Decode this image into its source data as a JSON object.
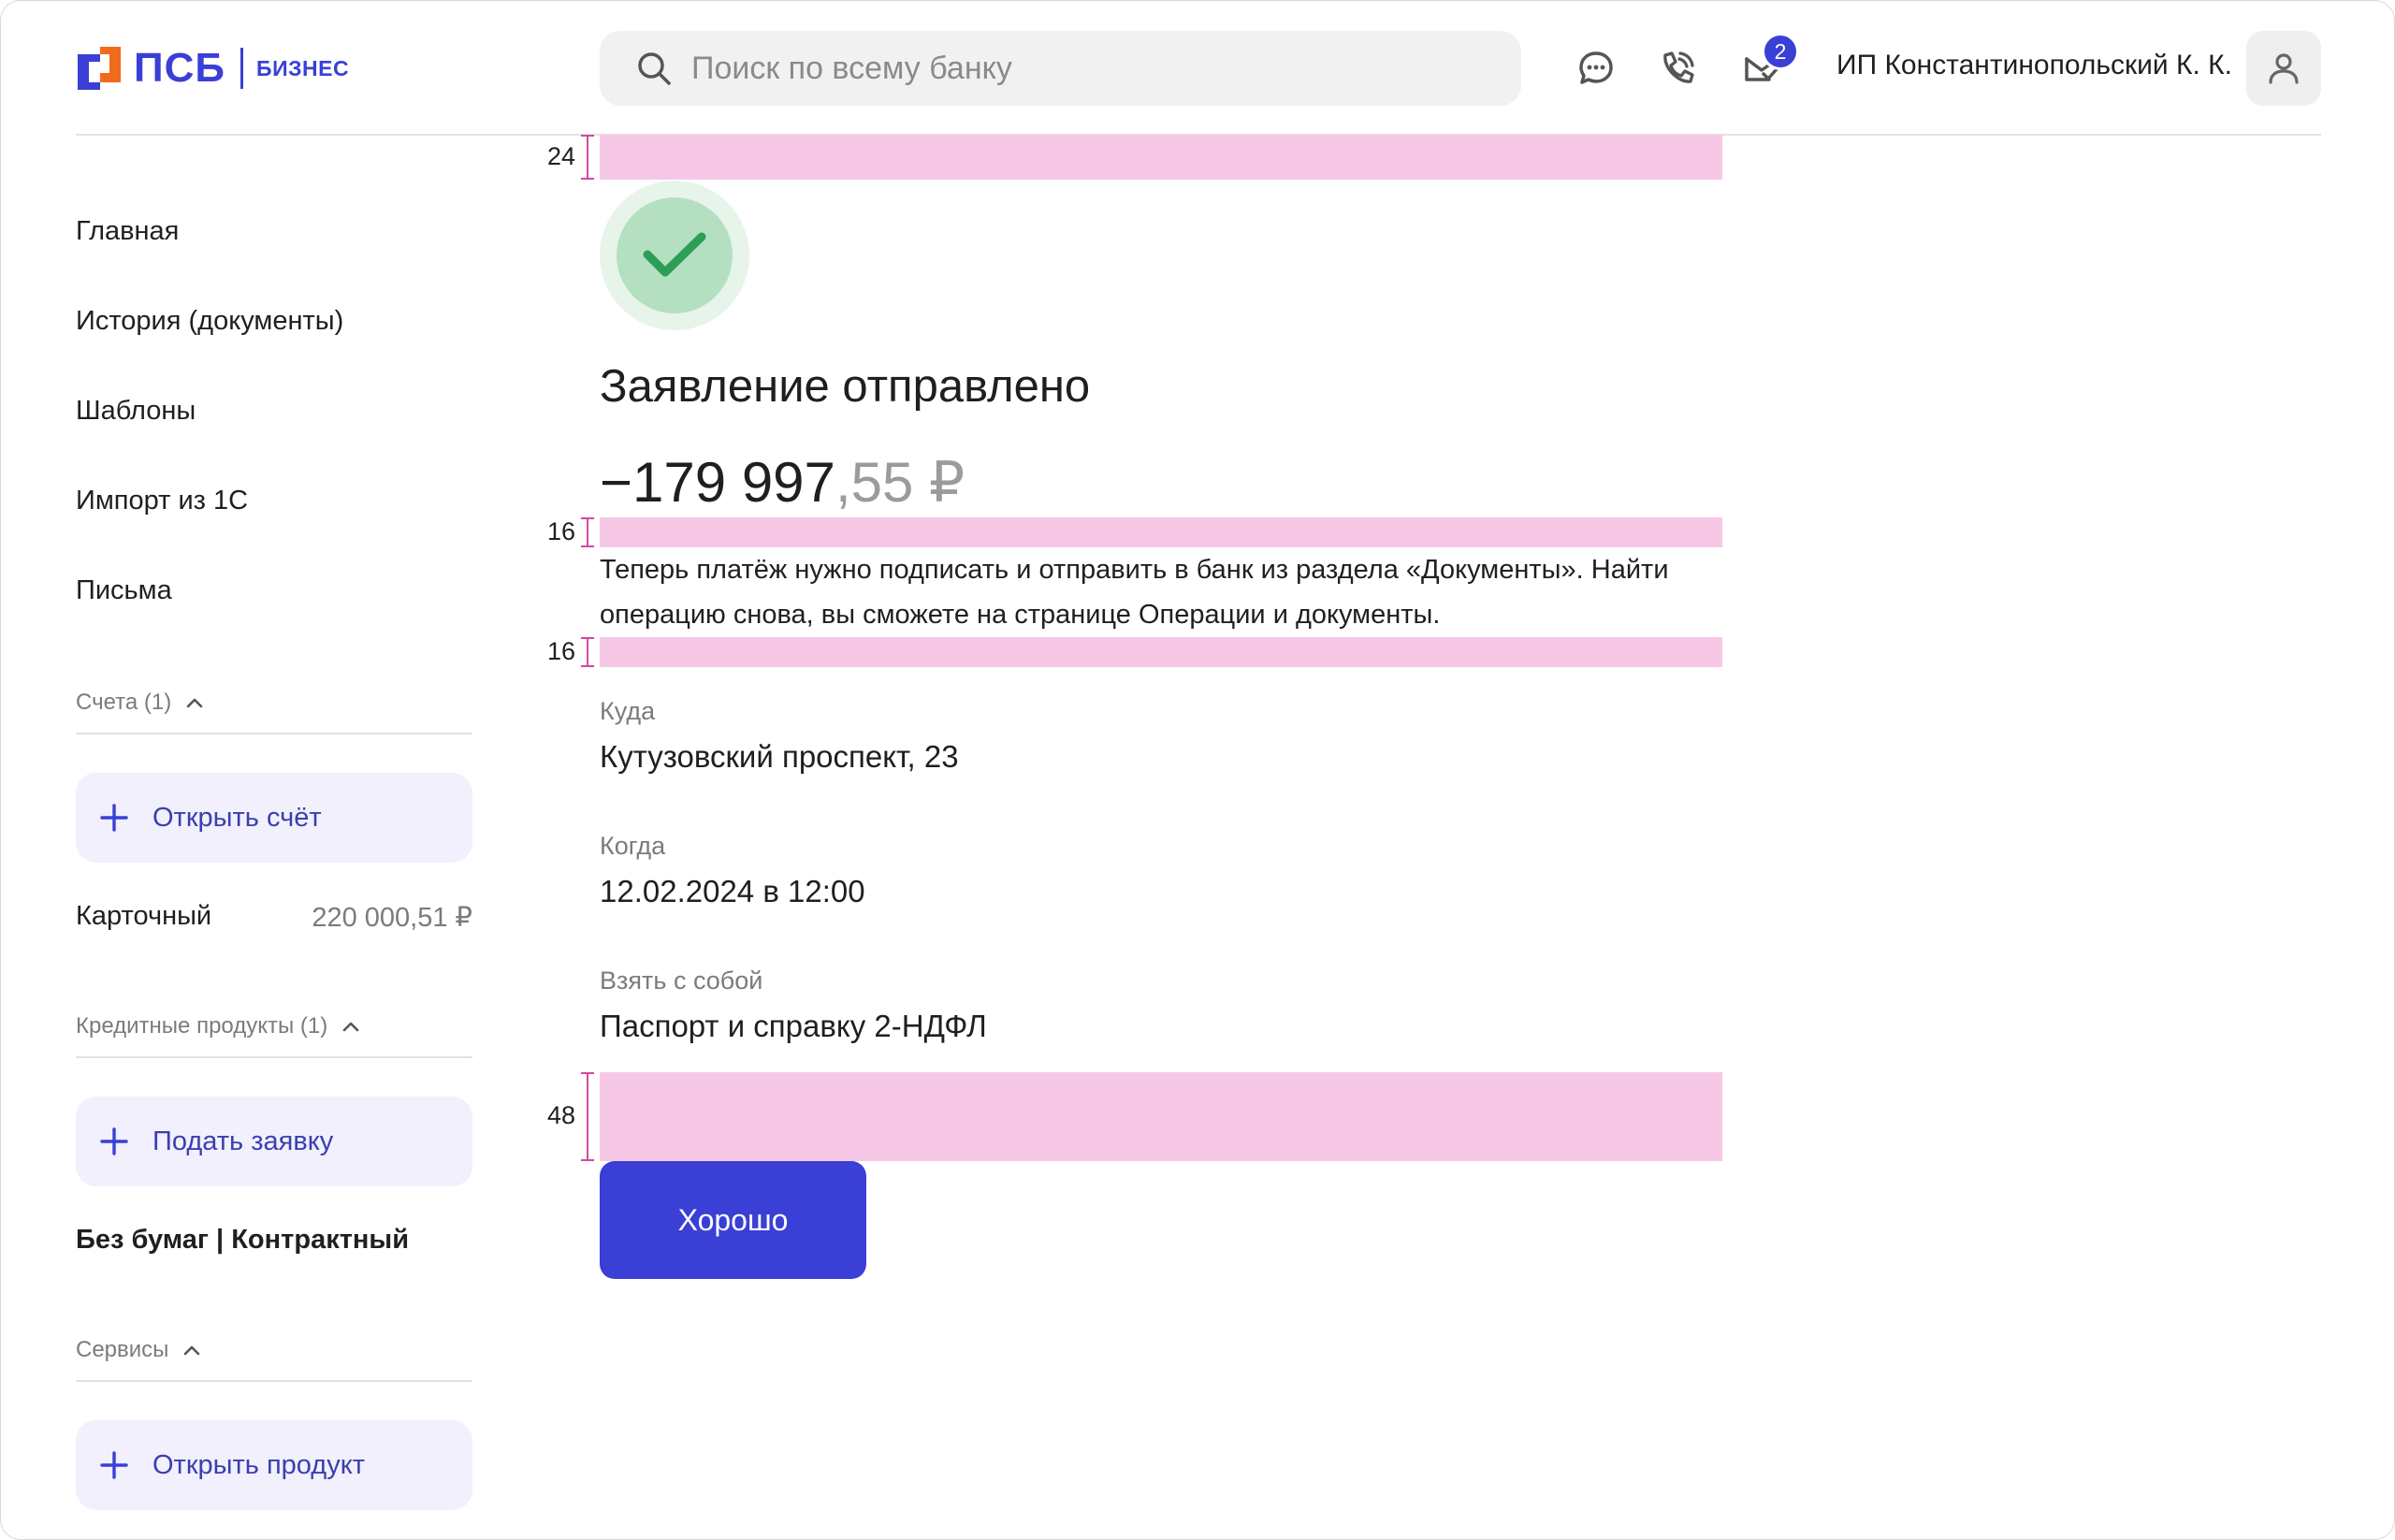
{
  "header": {
    "logo_text": "ПСБ",
    "logo_sub": "БИЗНЕС",
    "search_placeholder": "Поиск по всему банку",
    "notifications_count": "2",
    "user_name": "ИП Константинопольский К. К.",
    "icons": [
      "search-icon",
      "chat-icon",
      "phone-icon",
      "mail-check-icon",
      "user-icon"
    ],
    "accent_color": "#3a3fd6"
  },
  "sidebar": {
    "nav": [
      "Главная",
      "История (документы)",
      "Шаблоны",
      "Импорт из 1С",
      "Письма"
    ],
    "accounts": {
      "heading": "Счета (1)",
      "button": "Открыть счёт",
      "items": [
        {
          "name": "Карточный",
          "amount": "220 000,51 ₽"
        }
      ]
    },
    "credit": {
      "heading": "Кредитные продукты (1)",
      "button": "Подать заявку",
      "item": "Без бумаг | Контрактный"
    },
    "services": {
      "heading": "Сервисы",
      "button": "Открыть продукт"
    }
  },
  "main": {
    "spacers": {
      "top": "24",
      "after_amount": "16",
      "after_desc": "16",
      "before_button": "48"
    },
    "title": "Заявление отправлено",
    "amount_int": "−179 997",
    "amount_frac": ",55 ₽",
    "description": "Теперь платёж нужно подписать и отправить в банк из раздела «Документы». Найти операцию снова, вы сможете на странице Операции и документы.",
    "fields": [
      {
        "label": "Куда",
        "value": "Кутузовский проспект, 23"
      },
      {
        "label": "Когда",
        "value": "12.02.2024 в 12:00"
      },
      {
        "label": "Взять с собой",
        "value": "Паспорт и справку 2-НДФЛ"
      }
    ],
    "ok_button": "Хорошо",
    "success_color": "#2e9d55",
    "spacer_color": "#f6c8e6"
  }
}
